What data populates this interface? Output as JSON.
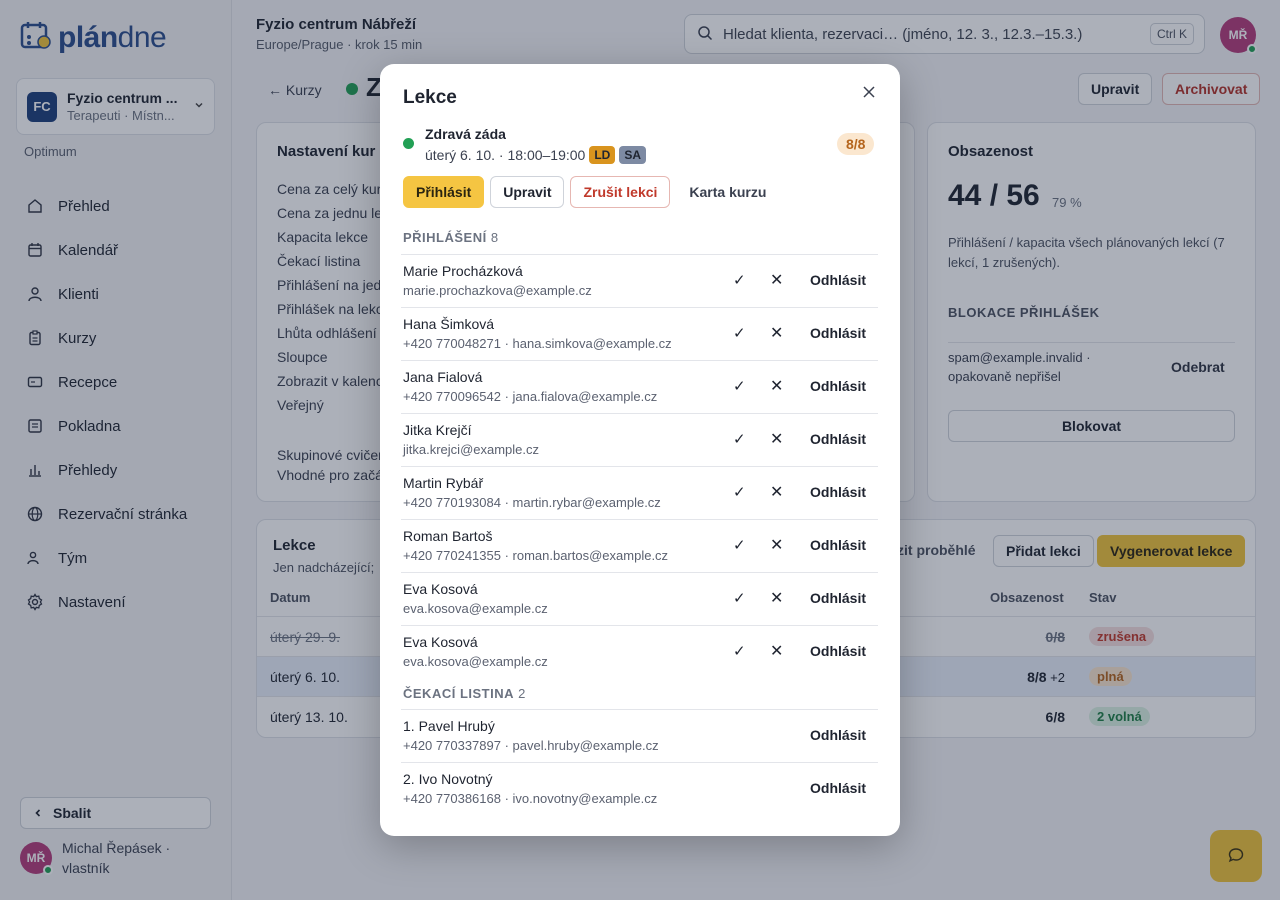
{
  "brand": {
    "logo_bold": "plán",
    "logo_light": "dne"
  },
  "org": {
    "initials": "FC",
    "name": "Fyzio centrum ...",
    "sub": "Terapeuti · Místn..."
  },
  "plan": "Optimum",
  "nav": [
    {
      "label": "Přehled",
      "icon": "home-icon"
    },
    {
      "label": "Kalendář",
      "icon": "calendar-icon"
    },
    {
      "label": "Klienti",
      "icon": "user-icon"
    },
    {
      "label": "Kurzy",
      "icon": "clipboard-icon"
    },
    {
      "label": "Recepce",
      "icon": "card-icon"
    },
    {
      "label": "Pokladna",
      "icon": "register-icon"
    },
    {
      "label": "Přehledy",
      "icon": "bar-chart-icon"
    },
    {
      "label": "Rezervační stránka",
      "icon": "globe-icon"
    },
    {
      "label": "Tým",
      "icon": "team-icon"
    },
    {
      "label": "Nastavení",
      "icon": "gear-icon"
    }
  ],
  "sidebar": {
    "collapse_label": "Sbalit"
  },
  "user": {
    "initials": "MŘ",
    "name_line1": "Michal Řepásek ·",
    "name_line2": "vlastník"
  },
  "header": {
    "title": "Fyzio centrum Nábřeží",
    "sub": "Europe/Prague · krok 15 min",
    "search_placeholder": "Hledat klienta, rezervaci… (jméno, 12. 3., 12.3.–15.3.)",
    "search_shortcut": "Ctrl K"
  },
  "page": {
    "back": "← Kurzy",
    "title": "Z",
    "edit": "Upravit",
    "archive": "Archivovat"
  },
  "settings": {
    "title": "Nastavení kur",
    "rows": [
      "Cena za celý kur",
      "Cena za jednu le",
      "Kapacita lekce",
      "Čekací listina",
      "Přihlášení na jedr",
      "Přihlášek na lekc",
      "Lhůta odhlášení (",
      "Sloupce",
      "Zobrazit v kalenc",
      "Veřejný"
    ],
    "tags_line1": "Skupinové cvičer",
    "tags_line2": "Vhodné pro začá"
  },
  "occupancy": {
    "title": "Obsazenost",
    "value": "44 / 56",
    "percent": "79 %",
    "desc": "Přihlášení / kapacita všech plánovaných lekcí (7 lekcí, 1 zrušených).",
    "block_title": "BLOKACE PŘIHLÁŠEK",
    "block_email_line1": "spam@example.invalid ·",
    "block_email_line2": "opakovaně nepřišel",
    "block_remove": "Odebrat",
    "block_button": "Blokovat"
  },
  "lessons": {
    "title": "Lekce",
    "sub": "Jen nadcházející;",
    "show_past": "zit proběhlé",
    "add": "Přidat lekci",
    "generate": "Vygenerovat lekce",
    "col_date": "Datum",
    "col_occ": "Obsazenost",
    "col_state": "Stav",
    "rows": [
      {
        "date": "úterý 29. 9.",
        "occ": "0/8",
        "extra": "",
        "state": "zrušena"
      },
      {
        "date": "úterý 6. 10.",
        "occ": "8/8",
        "extra": " +2",
        "state": "plná"
      },
      {
        "date": "úterý 13. 10.",
        "occ": "6/8",
        "extra": "",
        "state": "2 volná"
      }
    ]
  },
  "colors": {
    "accent": "#f5c542",
    "brand": "#2b4e8c",
    "success": "#22a055",
    "danger": "#c0392b"
  },
  "modal": {
    "title": "Lekce",
    "lesson_name": "Zdravá záda",
    "lesson_when": "úterý 6. 10. · 18:00–19:00",
    "tag1": "LD",
    "tag2": "SA",
    "count": "8/8",
    "btn_signup": "Přihlásit",
    "btn_edit": "Upravit",
    "btn_cancel": "Zrušit lekci",
    "btn_card": "Karta kurzu",
    "signed_title": "PŘIHLÁŠENÍ",
    "signed_count": "8",
    "check": "✓",
    "cross": "✕",
    "unsign": "Odhlásit",
    "participants": [
      {
        "name": "Marie Procházková",
        "contact": "marie.prochazkova@example.cz"
      },
      {
        "name": "Hana Šimková",
        "contact": "+420 770048271 · hana.simkova@example.cz"
      },
      {
        "name": "Jana Fialová",
        "contact": "+420 770096542 · jana.fialova@example.cz"
      },
      {
        "name": "Jitka Krejčí",
        "contact": "jitka.krejci@example.cz"
      },
      {
        "name": "Martin Rybář",
        "contact": "+420 770193084 · martin.rybar@example.cz"
      },
      {
        "name": "Roman Bartoš",
        "contact": "+420 770241355 · roman.bartos@example.cz"
      },
      {
        "name": "Eva Kosová",
        "contact": "eva.kosova@example.cz"
      },
      {
        "name": "Eva Kosová",
        "contact": "eva.kosova@example.cz"
      }
    ],
    "waitlist_title": "ČEKACÍ LISTINA",
    "waitlist_count": "2",
    "waitlist": [
      {
        "name": "1. Pavel Hrubý",
        "contact": "+420 770337897 · pavel.hruby@example.cz"
      },
      {
        "name": "2. Ivo Novotný",
        "contact": "+420 770386168 · ivo.novotny@example.cz"
      }
    ]
  }
}
